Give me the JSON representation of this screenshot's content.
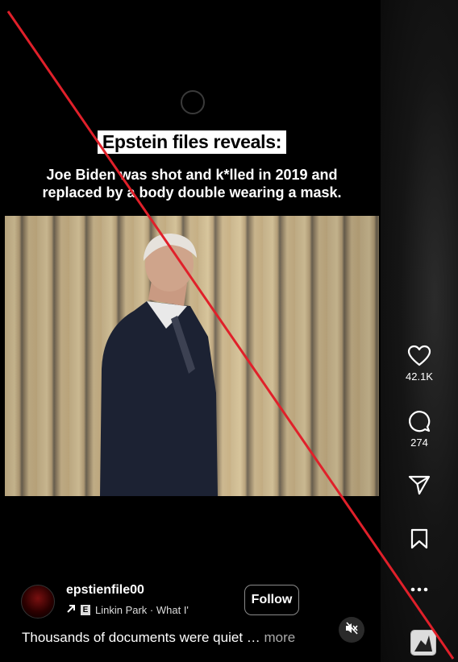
{
  "overlay": {
    "headline": "Epstein files reveals:",
    "subheadline": "Joe Biden was shot and k*lled in 2019 and replaced by a body double wearing a mask."
  },
  "post": {
    "username": "epstienfile00",
    "audio_badge": "E",
    "audio_text": "Linkin Park · What I'",
    "follow_label": "Follow",
    "caption_text": "Thousands of documents were quiet …",
    "caption_more": "more"
  },
  "actions": {
    "like_count": "42.1K",
    "comment_count": "274"
  },
  "icons": {
    "like": "heart-icon",
    "comment": "comment-icon",
    "share": "send-icon",
    "save": "bookmark-icon",
    "more": "more-icon",
    "mute": "muted-speaker-icon",
    "repost": "arrow-up-right-icon"
  },
  "colors": {
    "strike_line": "#e0202a",
    "background": "#000000",
    "caption_more": "#aaaaaa"
  }
}
